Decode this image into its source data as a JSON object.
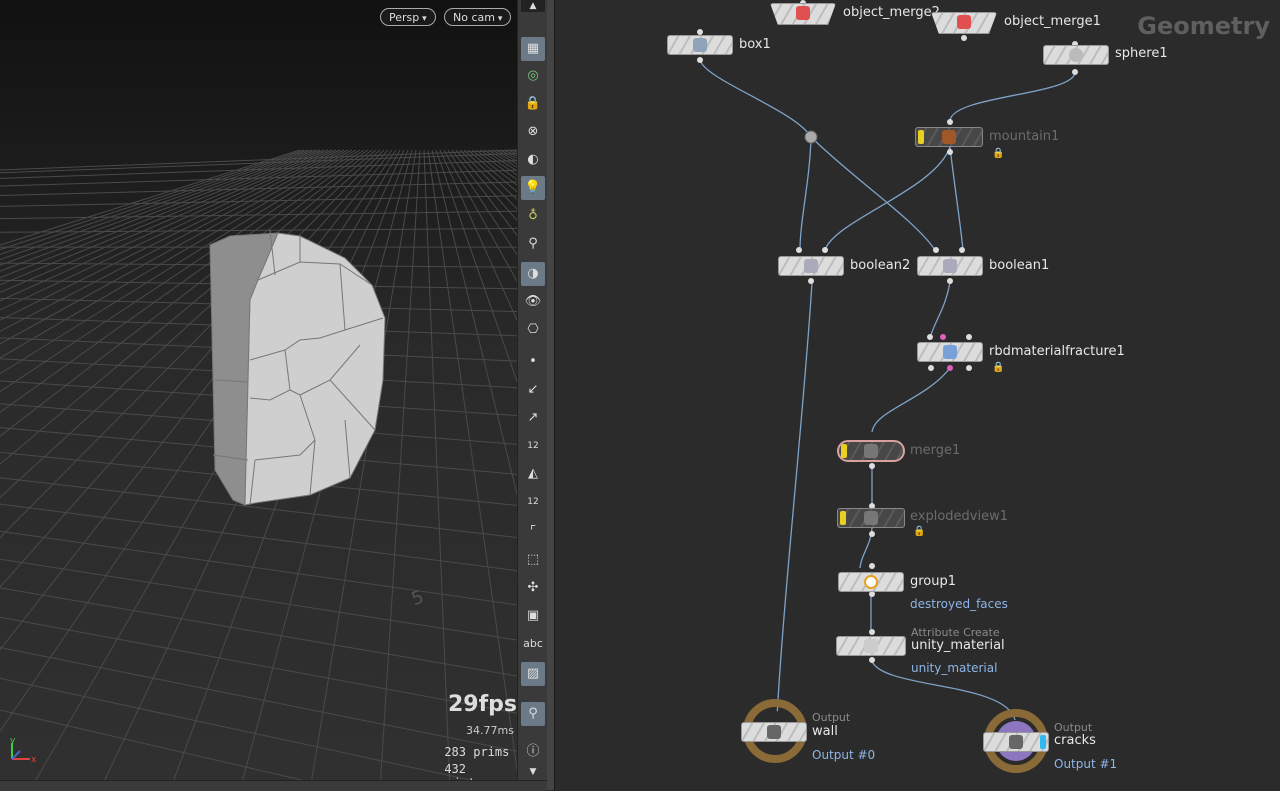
{
  "viewport": {
    "persp_label": "Persp",
    "cam_label": "No cam",
    "fps": "29fps",
    "ms": "34.77ms",
    "prims_count": "283",
    "prims_label": "prims",
    "points_count": "432",
    "points_label": "points",
    "grid_number": "5",
    "axis_y": "y",
    "axis_x": "x"
  },
  "toolbar": {
    "icons": [
      "select-icon",
      "visibility-icon",
      "lock-icon",
      "ghost-icon",
      "shading-icon",
      "light-icon",
      "headlight-icon",
      "lightbulb-icon",
      "render-icon",
      "eye-icon",
      "camera-icon",
      "point-icon",
      "normal-icon",
      "point-normal-icon",
      "point-number-icon",
      "face-icon",
      "face-number-icon",
      "edge-icon",
      "vertex-icon",
      "pivot-icon",
      "wireframe-icon",
      "text-icon",
      "background-icon",
      "pin-icon",
      "info-icon"
    ],
    "abc_label": "abc",
    "num_a": "12",
    "num_b": "12"
  },
  "network": {
    "context": "Geometry",
    "nodes": {
      "object_merge2": "object_merge2",
      "object_merge1": "object_merge1",
      "box1": "box1",
      "sphere1": "sphere1",
      "mountain1": "mountain1",
      "boolean2": "boolean2",
      "boolean1": "boolean1",
      "rbdmaterialfracture1": "rbdmaterialfracture1",
      "merge1": "merge1",
      "explodedview1": "explodedview1",
      "group1": "group1",
      "group1_sub": "destroyed_faces",
      "attr_type": "Attribute Create",
      "unity_material": "unity_material",
      "unity_material_sub": "unity_material",
      "out_type_a": "Output",
      "wall": "wall",
      "wall_sub": "Output #0",
      "out_type_b": "Output",
      "cracks": "cracks",
      "cracks_sub": "Output #1"
    }
  },
  "colors": {
    "flag": "#e8d020",
    "subtitle": "#8fb6e8",
    "wire": "#7ea3c8",
    "output_ring": "#8a6a36",
    "output_ring2": "#8d76c0"
  }
}
